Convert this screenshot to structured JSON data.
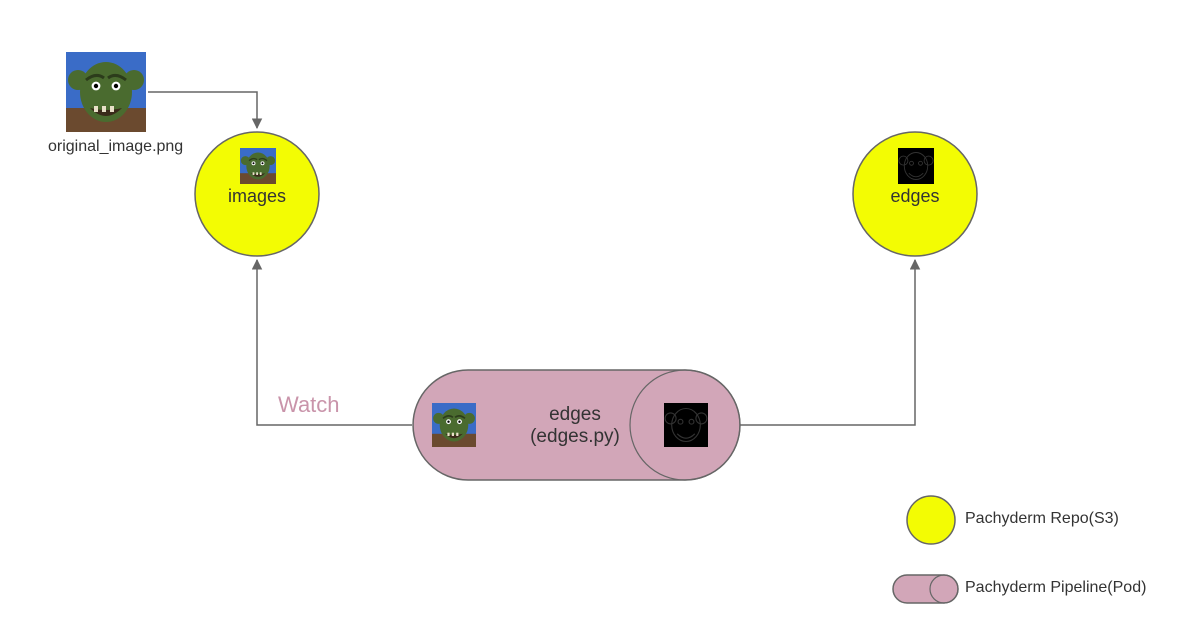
{
  "nodes": {
    "original_image": {
      "label": "original_image.png"
    },
    "images_repo": {
      "label": "images"
    },
    "edges_repo": {
      "label": "edges"
    },
    "pipeline": {
      "line1": "edges",
      "line2": "(edges.py)"
    }
  },
  "edge_labels": {
    "watch": "Watch"
  },
  "legend": {
    "repo": "Pachyderm Repo(S3)",
    "pipeline": "Pachyderm Pipeline(Pod)"
  },
  "colors": {
    "repo_fill": "#f3fc03",
    "pipeline_fill": "#d2a6b8",
    "stroke": "#666666",
    "watch_text": "#d2a6b8"
  }
}
